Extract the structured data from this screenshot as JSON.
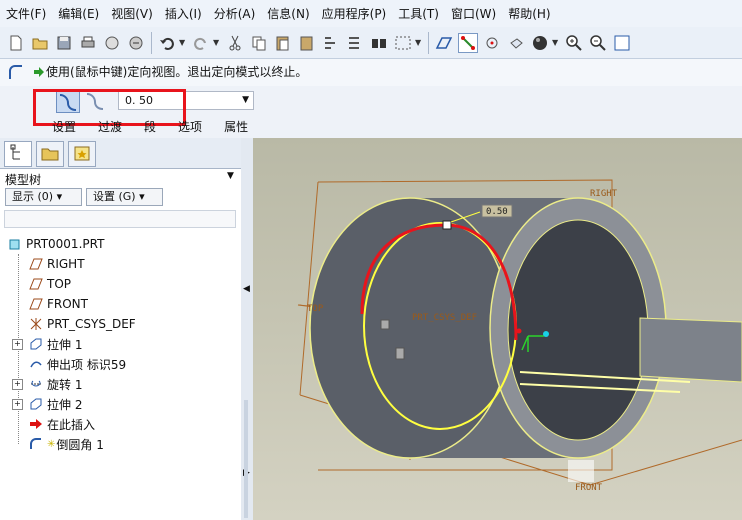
{
  "menu": [
    "文件(F)",
    "编辑(E)",
    "视图(V)",
    "插入(I)",
    "分析(A)",
    "信息(N)",
    "应用程序(P)",
    "工具(T)",
    "窗口(W)",
    "帮助(H)"
  ],
  "message": "使用(鼠标中键)定向视图。退出定向模式以终止。",
  "dashboard": {
    "value": "0. 50",
    "tabs": [
      "设置",
      "过渡",
      "段",
      "选项",
      "属性"
    ]
  },
  "model_tree": {
    "title": "模型树",
    "show_button": "显示 (0) ▾",
    "settings_button": "设置 (G) ▾",
    "items": [
      {
        "label": "PRT0001.PRT",
        "icon": "part-icon"
      },
      {
        "label": "RIGHT",
        "icon": "datum-plane-icon"
      },
      {
        "label": "TOP",
        "icon": "datum-plane-icon"
      },
      {
        "label": "FRONT",
        "icon": "datum-plane-icon"
      },
      {
        "label": "PRT_CSYS_DEF",
        "icon": "csys-icon"
      },
      {
        "label": "拉伸 1",
        "icon": "extrude-icon"
      },
      {
        "label": "伸出项 标识59",
        "icon": "protrusion-icon"
      },
      {
        "label": "旋转 1",
        "icon": "revolve-icon"
      },
      {
        "label": "拉伸 2",
        "icon": "extrude-icon"
      },
      {
        "label": "在此插入",
        "icon": "insert-here-icon"
      },
      {
        "label": "倒圆角 1",
        "icon": "round-icon"
      }
    ]
  },
  "viewport": {
    "dimension": "0.50",
    "datum_right": "RIGHT",
    "datum_top": "TOP",
    "datum_front": "FRONT",
    "csys": "PRT_CSYS_DEF"
  },
  "colors": {
    "highlight_box": "#e8141c",
    "selection": "#e8141c",
    "preview": "#ffff40"
  }
}
